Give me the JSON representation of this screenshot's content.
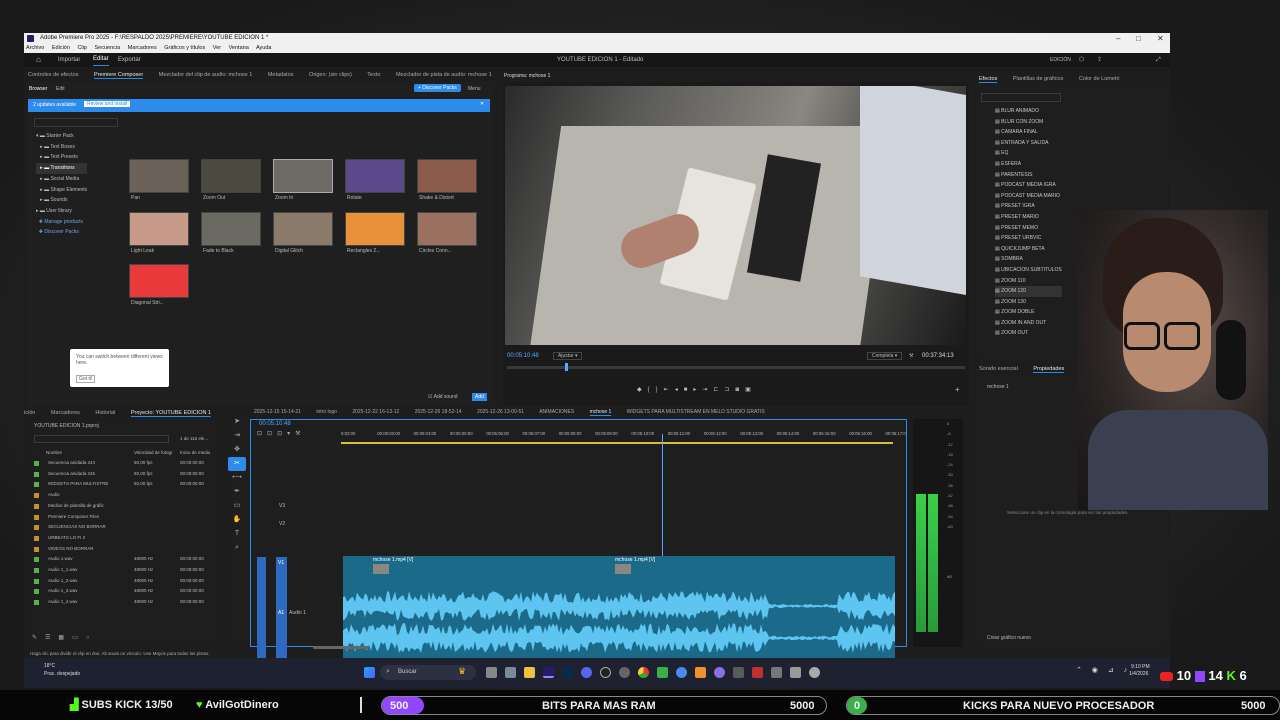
{
  "window": {
    "title": "Adobe Premiere Pro 2025 - F:\\RESPALDO 2025\\PREMIERE\\YOUTUBE EDICION 1 *",
    "menu": [
      "Archivo",
      "Edición",
      "Clip",
      "Secuencia",
      "Marcadores",
      "Gráficos y títulos",
      "Ver",
      "Ventana",
      "Ayuda"
    ],
    "workspace_tabs": [
      "Importar",
      "Editar",
      "Exportar"
    ],
    "active_workspace": "Editar",
    "center_title": "YOUTUBE EDICION 1 - Editado",
    "right_label": "EDICIÓN"
  },
  "source_tabs": [
    "Controles de efectos",
    "Premiere Composer",
    "Mezclador del clip de audio: mchose 1",
    "Metadatos",
    "Origen: (sin clips)",
    "Texto",
    "Mezclador de pista de audio: mchose 1"
  ],
  "composer": {
    "browser_tab": "Browser",
    "edit_tab": "Edit",
    "discover_button": "+ Discover Packs",
    "menu_label": "Menu",
    "updates_text": "2 updates available",
    "review_button": "Review and install",
    "tree": [
      "Starter Pack",
      "Text Boxes",
      "Text Presets",
      "Transitions",
      "Social Media",
      "Shape Elements",
      "Sounds",
      "User library",
      "Manage products",
      "Discover Packs"
    ],
    "items": [
      {
        "label": "Pan",
        "color": "#6a6258"
      },
      {
        "label": "Zoom Out",
        "color": "#4a4a40"
      },
      {
        "label": "Zoom In",
        "color": "#6e6a66"
      },
      {
        "label": "Rotate",
        "color": "#5a4a8a"
      },
      {
        "label": "Shake & Distort",
        "color": "#8a5a4a"
      },
      {
        "label": "Light Leak",
        "color": "#c89a8a"
      },
      {
        "label": "Fade to Black",
        "color": "#6a6a62"
      },
      {
        "label": "Digital Glitch",
        "color": "#8a7a6a"
      },
      {
        "label": "Rectangles 2...",
        "color": "#e8903a"
      },
      {
        "label": "Circles Conn...",
        "color": "#9a7060"
      },
      {
        "label": "Diagonal Stri...",
        "color": "#e83a3a"
      }
    ],
    "tooltip_text": "You can switch between different views here.",
    "tooltip_button": "Got it!",
    "add_sound": "Add sound",
    "add_button": "Add"
  },
  "program": {
    "title": "Programa: mchose 1",
    "timecode_in": "00:05:10:48",
    "fit": "Ajustar",
    "quality": "Completa",
    "timecode_total": "00:37:34:13"
  },
  "effects": {
    "tabs": [
      "Efectos",
      "Plantillas de gráficos",
      "Color de Lumetri"
    ],
    "items": [
      "BLUR ANIMADO",
      "BLUR CON ZOOM",
      "CAMARA FINAL",
      "ENTRADA Y SALIDA",
      "EQ",
      "ESFERA",
      "PARENTESIS",
      "PODCAST MEDIA IGRA",
      "PODCAST MEDIA MARIO",
      "PRESET IGRA",
      "PRESET MARIO",
      "PRESET MEMO",
      "PRESET URBVIC",
      "QUICKJUMP BETA",
      "SOMBRA",
      "UBICACION SUBTITULOS",
      "ZOOM 110",
      "ZOOM 120",
      "ZOOM 130",
      "ZOOM DOBLE",
      "ZOOM IN AND OUT",
      "ZOOM OUT"
    ]
  },
  "properties": {
    "tabs": [
      "Sonido esencial",
      "Propiedades"
    ],
    "item": "mchose 1",
    "hint": "Seleccione un clip en la cronología para ver las propiedades.",
    "bottom_button": "Crear gráfico nuevo"
  },
  "project": {
    "tabs": [
      "ición",
      "Marcadores",
      "Historial",
      "Proyecto: YOUTUBE EDICION 1"
    ],
    "file": "YOUTUBE EDICION 1.prproj",
    "count": "1 de 116 ele...",
    "headers": [
      "Nombre",
      "Velocidad de fotogr",
      "Inicio de medio"
    ],
    "rows": [
      {
        "name": "Secuencia anidada 244",
        "rate": "60,00 fps",
        "start": "00:00:00:00",
        "color": "#5ab04a"
      },
      {
        "name": "Secuencia anidada 245",
        "rate": "60,00 fps",
        "start": "00:00:00:00",
        "color": "#5ab04a"
      },
      {
        "name": "WIDGETS PARA MULTISTRE",
        "rate": "60,00 fps",
        "start": "00:00:00:00",
        "color": "#5ab04a"
      },
      {
        "name": "Audio",
        "rate": "",
        "start": "",
        "color": "#c09030"
      },
      {
        "name": "Medios de plantilla de gráfic",
        "rate": "",
        "start": "",
        "color": "#c09030"
      },
      {
        "name": "Premiere Composer Files",
        "rate": "",
        "start": "",
        "color": "#c09030"
      },
      {
        "name": "SECUENCIAS NO BORRAR",
        "rate": "",
        "start": "",
        "color": "#c09030"
      },
      {
        "name": "URBEATS LO FI 2",
        "rate": "",
        "start": "",
        "color": "#c09030"
      },
      {
        "name": "VIDEOS NO BORRAR",
        "rate": "",
        "start": "",
        "color": "#c09030"
      },
      {
        "name": "Audio 1.wav",
        "rate": "48000 Hz",
        "start": "00:00:00:00",
        "color": "#5ab04a"
      },
      {
        "name": "Audio 1_1.wav",
        "rate": "48000 Hz",
        "start": "00:00:00:00",
        "color": "#5ab04a"
      },
      {
        "name": "Audio 1_2.wav",
        "rate": "48000 Hz",
        "start": "00:00:00:00",
        "color": "#5ab04a"
      },
      {
        "name": "Audio 1_3.wav",
        "rate": "48000 Hz",
        "start": "00:00:00:00",
        "color": "#5ab04a"
      },
      {
        "name": "Audio 1_4.wav",
        "rate": "48000 Hz",
        "start": "00:00:00:00",
        "color": "#5ab04a"
      }
    ]
  },
  "timeline": {
    "tabs": [
      "2025-12-15 15-14-21",
      "intro logo",
      "2025-12-22 16-13-12",
      "2025-12-26 18-52-14",
      "2025-12-26 13-00-51",
      "ANIMACIONES",
      "mchose 1",
      "WIDGETS PARA MULTISTREAM EN MELD STUDIO GRATIS"
    ],
    "active_tab": "mchose 1",
    "timecode": "00:05:10:48",
    "ruler": [
      "0:02:00",
      "00:05:03:00",
      "00:05:04:00",
      "00:05:05:00",
      "00:05:06:00",
      "00:05:07:00",
      "00:05:08:00",
      "00:05:09:00",
      "00:05:10:00",
      "00:05:11:00",
      "00:05:12:00",
      "00:05:13:00",
      "00:05:14:00",
      "00:05:15:00",
      "00:05:16:00",
      "00:05:17:0"
    ],
    "tracks": [
      "V3",
      "V2",
      "V1",
      "A1"
    ],
    "clip1": "mchose 1.mp4 [V]",
    "clip2": "mchose 1.mp4 [V]",
    "audio_label": "Audio 1",
    "meter_labels": [
      "0",
      "-6",
      "-12",
      "-18",
      "-24",
      "-30",
      "-36",
      "-42",
      "-48",
      "-54",
      "-60",
      "dB"
    ]
  },
  "status_text": "Haga clic para dividir el clip en dos. Alt anula un vínculo. Use Mayús para todas las pistas.",
  "taskbar": {
    "weather_temp": "18°C",
    "weather_desc": "Prac. despejado",
    "search": "Buscar",
    "time": "9:10 PM",
    "date": "1/4/2026"
  },
  "overlay": {
    "subs_kick": "SUBS KICK 13/50",
    "donor": "AvilGotDinero",
    "bits_count": "500",
    "bits_goal": "BITS PARA MAS RAM",
    "bits_target": "5000",
    "kicks_count": "0",
    "kicks_goal": "KICKS PARA NUEVO PROCESADOR",
    "kicks_target": "5000",
    "youtube_count": "10",
    "twitch_count": "14",
    "kick_count": "6"
  }
}
